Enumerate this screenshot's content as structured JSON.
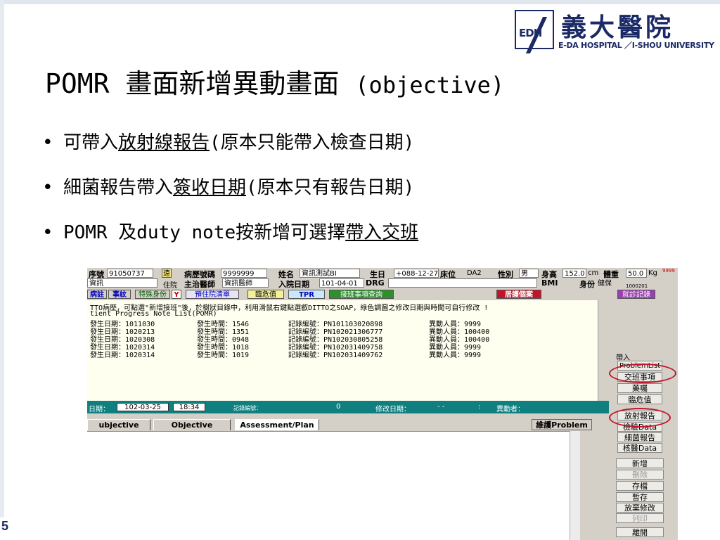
{
  "slide": {
    "title_main": "POMR 畫面新增異動畫面",
    "title_sub": "(objective)",
    "bullets": [
      {
        "pre": "可帶入",
        "u": "放射線報告",
        "post": "(原本只能帶入檢查日期)"
      },
      {
        "pre": "細菌報告帶入",
        "u": "簽收日期",
        "post": "(原本只有報告日期)"
      },
      {
        "pre": "POMR 及duty note按新增可選擇",
        "u": "帶入交班",
        "post": ""
      }
    ],
    "bullet_char": "•",
    "page_number": "5"
  },
  "logo": {
    "mark": "EDH",
    "chinese": "義大醫院",
    "english": "E-DA HOSPITAL ／I-SHOU UNIVERSITY"
  },
  "emr": {
    "row1": {
      "seq_label": "序號",
      "seq_value": "91050737",
      "seq_icon": "遠",
      "chart_label": "病歷號碼",
      "chart_value": "9999999",
      "name_label": "姓名",
      "name_value": "資訊測試BI",
      "birth_label": "生日",
      "birth_value": "+088-12-27",
      "bed_label": "床位",
      "bed_value": "DA2",
      "sex_label": "性別",
      "sex_value": "男",
      "height_label": "身高",
      "height_value": "152.0",
      "height_unit": "cm",
      "weight_label": "體重",
      "weight_value": "50.0",
      "weight_unit": "Kg",
      "weight_extra": "9999"
    },
    "row2": {
      "dept_value": "資訊",
      "ward_label": "住院",
      "doctor_label": "主治醫師",
      "doctor_value": "資訊醫師",
      "admit_label": "入院日期",
      "admit_value": "101-04-01",
      "drg_label": "DRG",
      "bmi_label": "BMI",
      "identity_label": "身份",
      "identity_value": "健保",
      "id_small": "1000201"
    },
    "toolbar": {
      "items": [
        "病註",
        "事紋",
        "特殊身份",
        "Y",
        "預住院清單",
        "臨危值",
        "TPR",
        "接班事項查詢",
        "居護個案",
        "就診記錄"
      ]
    },
    "notes": {
      "instruction": "TTO病歷，可點選\"新增接班\"後，於樹狀目錄中，利用滑鼠右鍵點選叡DITTO之SOAP，綠色調圖之修改日期與時間可自行修改 !",
      "list_title": "tient Progress Note List(POMR)",
      "rows": [
        {
          "date": "發生日期：1011030",
          "time": "發生時間：1546",
          "rec": "記錄編號：PN101103020898",
          "who": "異動人員：9999"
        },
        {
          "date": "發生日期：1020213",
          "time": "發生時間：1351",
          "rec": "記錄編號：PN102021306777",
          "who": "異動人員：100400"
        },
        {
          "date": "發生日期：1020308",
          "time": "發生時間：0948",
          "rec": "記錄編號：PN102030805258",
          "who": "異動人員：100400"
        },
        {
          "date": "發生日期：1020314",
          "time": "發生時間：1018",
          "rec": "記錄編號：PN102031409758",
          "who": "異動人員：9999"
        },
        {
          "date": "發生日期：1020314",
          "time": "發生時間：1019",
          "rec": "記錄編號：PN102031409762",
          "who": "異動人員：9999"
        }
      ]
    },
    "status": {
      "date_label": "日期：",
      "date_value": "102-03-25",
      "time_value": "18:34",
      "record_label": "記錄編號：",
      "record_value": "0",
      "modify_label": "修改日期：",
      "modify_value": "-   -",
      "colon": ":",
      "changer_label": "異動者："
    },
    "tabs": [
      "ubjective",
      "Objective",
      "Assessment/Plan"
    ],
    "maintain_problem": "維護Problem",
    "insert_panel": {
      "title": "帶入",
      "buttons": [
        "ProblemList",
        "交班事項",
        "藥囑",
        "臨危值",
        "放射報告",
        "檢驗Data",
        "細菌報告",
        "核醫Data"
      ]
    },
    "actions": [
      "新增",
      "刪除",
      "存檔",
      "暫存",
      "放棄修改",
      "列印",
      "離開"
    ],
    "colors": {
      "teal": "#0f7f80",
      "annotation_red": "#c0152a",
      "navy": "#1b2a66"
    }
  }
}
